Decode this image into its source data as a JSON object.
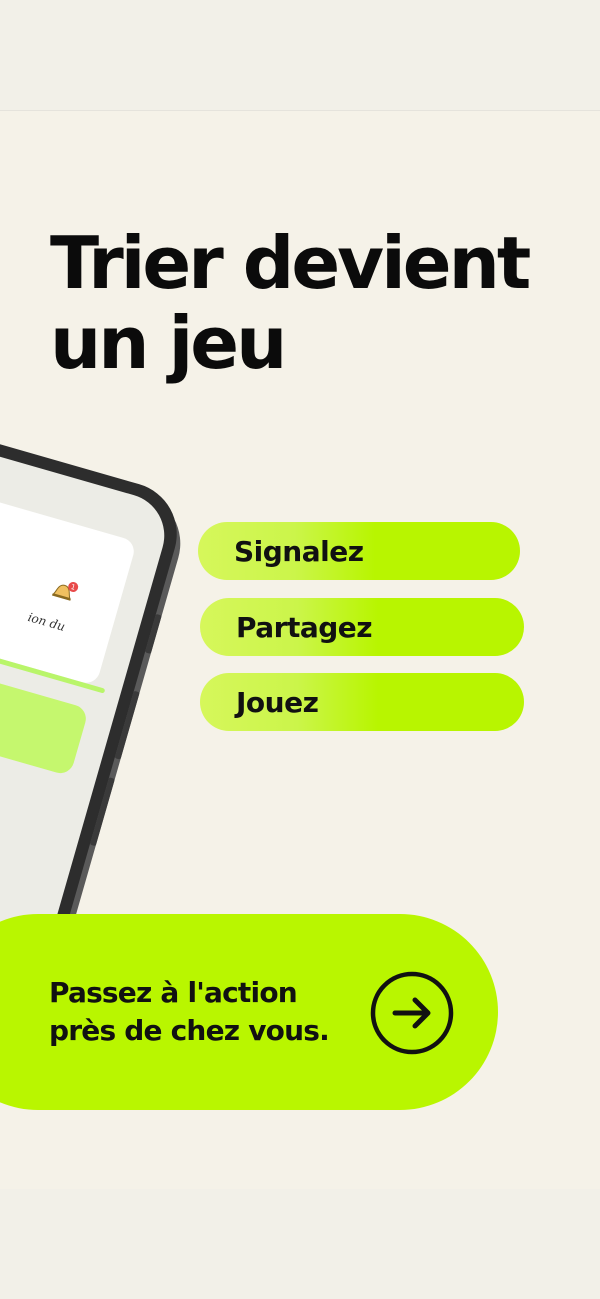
{
  "headline": {
    "line1": "Trier devient",
    "line2": "un jeu"
  },
  "phone": {
    "screen_text": "ion du",
    "notification_count": "1"
  },
  "pills": [
    {
      "label": "Signalez"
    },
    {
      "label": "Partagez"
    },
    {
      "label": "Jouez"
    }
  ],
  "cta": {
    "line1": "Passez à l'action",
    "line2": "près de chez vous.",
    "button_icon": "arrow-right-circle-icon"
  },
  "colors": {
    "background": "#f5f2e8",
    "accent_green": "#b9f600",
    "text": "#111111"
  }
}
